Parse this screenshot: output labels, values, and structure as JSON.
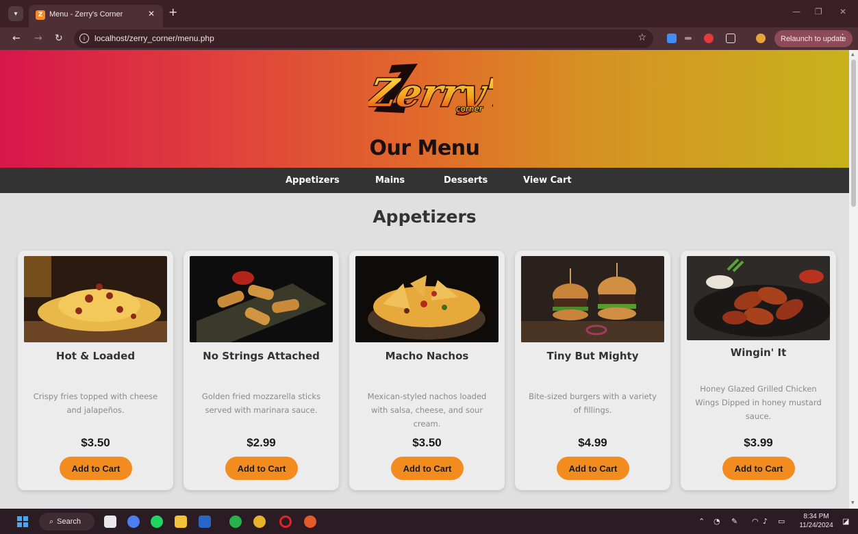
{
  "browser": {
    "tab_title": "Menu - Zerry's Corner",
    "url": "localhost/zerry_corner/menu.php",
    "relaunch_label": "Relaunch to update",
    "icons": [
      "tab-search-icon",
      "close-icon",
      "plus-icon",
      "back-arrow-icon",
      "forward-arrow-icon",
      "reload-icon",
      "site-info-icon",
      "star-icon",
      "extensions-icon",
      "profile-icon",
      "more-vert-icon"
    ]
  },
  "header": {
    "logo_text": "Zerry's",
    "logo_subtext": "corner",
    "title": "Our Menu"
  },
  "nav": {
    "items": [
      {
        "label": "Appetizers"
      },
      {
        "label": "Mains"
      },
      {
        "label": "Desserts"
      },
      {
        "label": "View Cart"
      }
    ]
  },
  "section": {
    "title": "Appetizers"
  },
  "items": [
    {
      "name": "Hot & Loaded",
      "description": "Crispy fries topped with cheese and jalapeños.",
      "price": "$3.50",
      "button": "Add to Cart"
    },
    {
      "name": "No Strings Attached",
      "description": "Golden fried mozzarella sticks served with marinara sauce.",
      "price": "$2.99",
      "button": "Add to Cart"
    },
    {
      "name": "Macho Nachos",
      "description": "Mexican-styled nachos loaded with salsa, cheese, and sour cream.",
      "price": "$3.50",
      "button": "Add to Cart"
    },
    {
      "name": "Tiny But Mighty",
      "description": "Bite-sized burgers with a variety of fillings.",
      "price": "$4.99",
      "button": "Add to Cart"
    },
    {
      "name": "Wingin' It",
      "description": "Honey Glazed Grilled Chicken Wings Dipped in honey mustard sauce.",
      "price": "$3.99",
      "button": "Add to Cart"
    }
  ],
  "taskbar": {
    "search_label": "Search",
    "time": "8:34 PM",
    "date": "11/24/2024"
  },
  "colors": {
    "accent": "#f28c1e",
    "nav_bg": "#333333",
    "hero_gradient_start": "#d8164a",
    "hero_gradient_end": "#c7b21d"
  }
}
